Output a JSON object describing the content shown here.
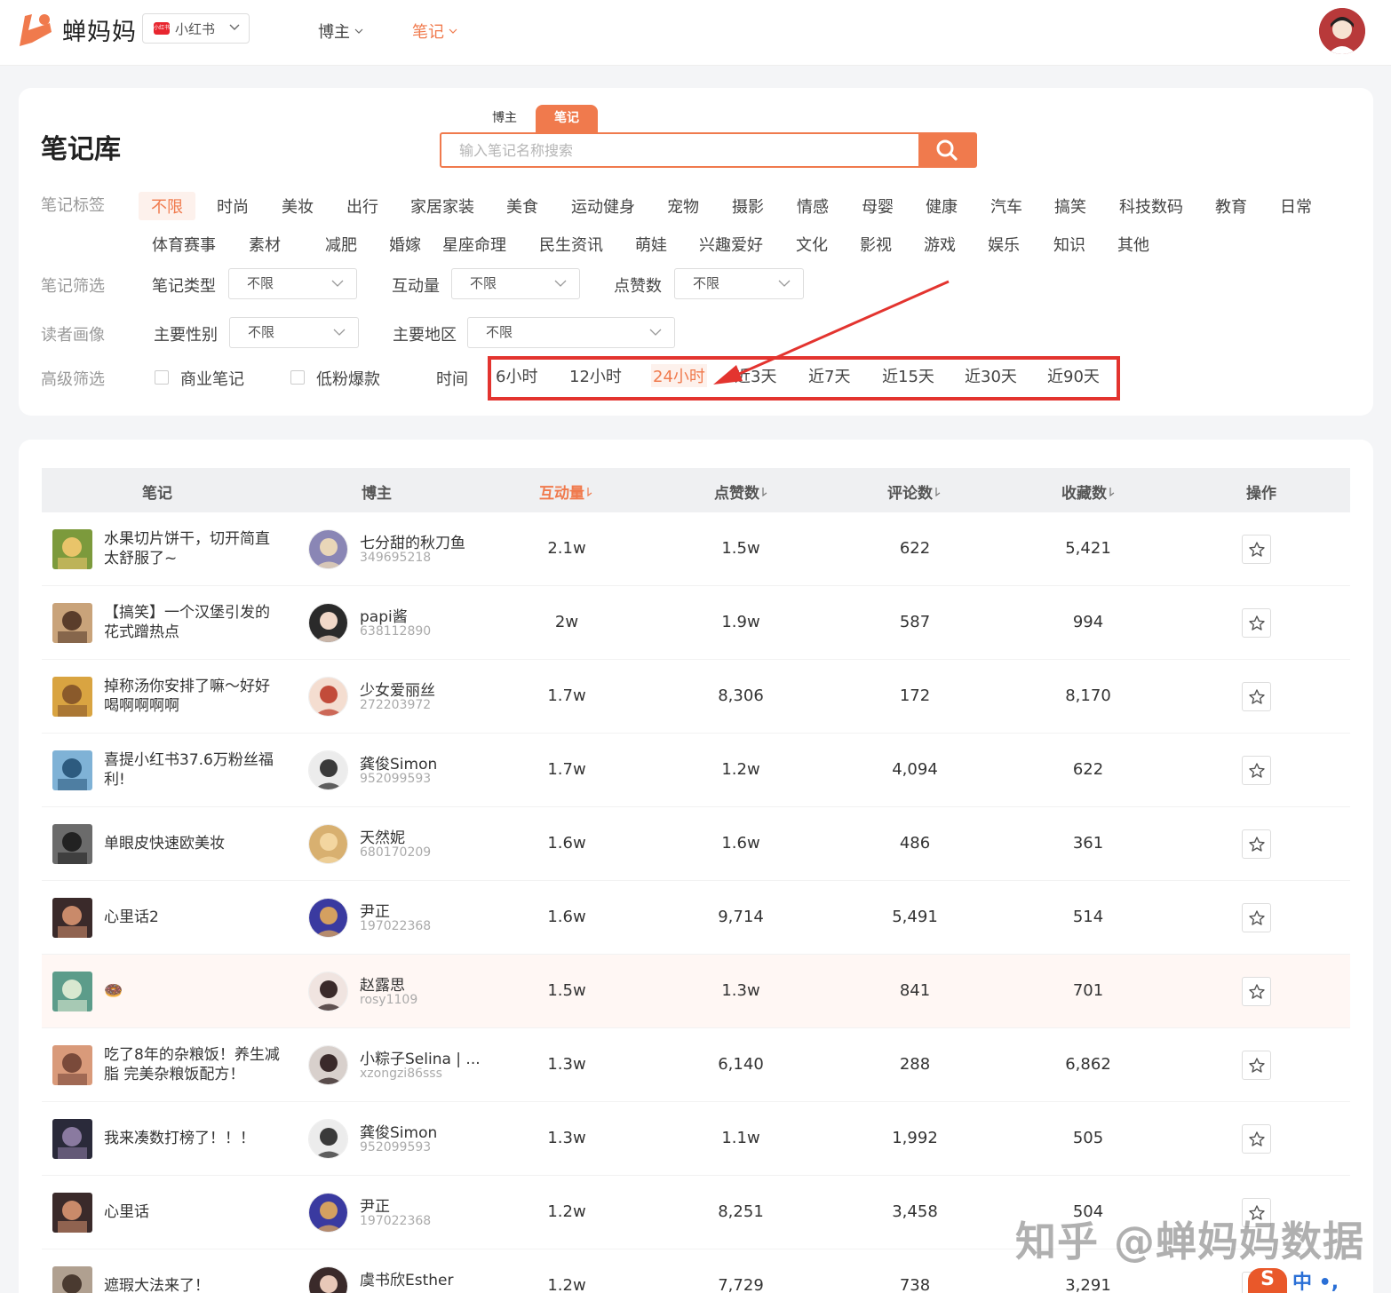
{
  "app": {
    "brand": "蝉妈妈",
    "platform": "小红书",
    "platform_badge": "小红书",
    "nav": [
      {
        "label": "博主",
        "active": false
      },
      {
        "label": "笔记",
        "active": true
      }
    ]
  },
  "filter": {
    "title": "笔记库",
    "search_tabs": [
      "博主",
      "笔记"
    ],
    "search_placeholder": "输入笔记名称搜索",
    "labels": {
      "tags": "笔记标签",
      "filter": "笔记筛选",
      "reader": "读者画像",
      "advanced": "高级筛选"
    },
    "tags_row1": [
      "不限",
      "时尚",
      "美妆",
      "出行",
      "家居家装",
      "美食",
      "运动健身",
      "宠物",
      "摄影",
      "情感",
      "母婴",
      "健康",
      "汽车",
      "搞笑",
      "科技数码",
      "教育",
      "日常"
    ],
    "tags_row2": [
      "体育赛事",
      "素材",
      "减肥",
      "婚嫁",
      "星座命理",
      "民生资讯",
      "萌娃",
      "兴趣爱好",
      "文化",
      "影视",
      "游戏",
      "娱乐",
      "知识",
      "其他"
    ],
    "note_filters": [
      {
        "label": "笔记类型",
        "value": "不限"
      },
      {
        "label": "互动量",
        "value": "不限"
      },
      {
        "label": "点赞数",
        "value": "不限"
      }
    ],
    "reader_filters": [
      {
        "label": "主要性别",
        "value": "不限"
      },
      {
        "label": "主要地区",
        "value": "不限"
      }
    ],
    "checks": [
      "商业笔记",
      "低粉爆款"
    ],
    "time_label": "时间",
    "time_options": [
      "6小时",
      "12小时",
      "24小时",
      "近3天",
      "近7天",
      "近15天",
      "近30天",
      "近90天"
    ],
    "time_selected": "24小时"
  },
  "table": {
    "headers": [
      "笔记",
      "博主",
      "互动量",
      "点赞数",
      "评论数",
      "收藏数",
      "操作"
    ],
    "sorted_column": "互动量",
    "rows": [
      {
        "title": "水果切片饼干，切开简直太舒服了~",
        "blogger": "七分甜的秋刀鱼",
        "id": "349695218",
        "interact": "2.1w",
        "likes": "1.5w",
        "comments": "622",
        "favs": "5,421"
      },
      {
        "title": "【搞笑】一个汉堡引发的花式蹭热点",
        "blogger": "papi酱",
        "id": "638112890",
        "interact": "2w",
        "likes": "1.9w",
        "comments": "587",
        "favs": "994"
      },
      {
        "title": "掉称汤你安排了嘛～好好喝啊啊啊啊",
        "blogger": "少女爱丽丝",
        "id": "272203972",
        "interact": "1.7w",
        "likes": "8,306",
        "comments": "172",
        "favs": "8,170"
      },
      {
        "title": "喜提小红书37.6万粉丝福利!",
        "blogger": "龚俊Simon",
        "id": "952099593",
        "interact": "1.7w",
        "likes": "1.2w",
        "comments": "4,094",
        "favs": "622"
      },
      {
        "title": "单眼皮快速欧美妆",
        "blogger": "天然妮",
        "id": "680170209",
        "interact": "1.6w",
        "likes": "1.6w",
        "comments": "486",
        "favs": "361"
      },
      {
        "title": "心里话2",
        "blogger": "尹正",
        "id": "197022368",
        "interact": "1.6w",
        "likes": "9,714",
        "comments": "5,491",
        "favs": "514"
      },
      {
        "title": "🍩",
        "blogger": "赵露思",
        "id": "rosy1109",
        "interact": "1.5w",
        "likes": "1.3w",
        "comments": "841",
        "favs": "701"
      },
      {
        "title": "吃了8年的杂粮饭！养生减脂 完美杂粮饭配方！",
        "blogger": "小粽子Selina | ...",
        "id": "xzongzi86sss",
        "interact": "1.3w",
        "likes": "6,140",
        "comments": "288",
        "favs": "6,862"
      },
      {
        "title": "我来凑数打榜了！！！",
        "blogger": "龚俊Simon",
        "id": "952099593",
        "interact": "1.3w",
        "likes": "1.1w",
        "comments": "1,992",
        "favs": "505"
      },
      {
        "title": "心里话",
        "blogger": "尹正",
        "id": "197022368",
        "interact": "1.2w",
        "likes": "8,251",
        "comments": "3,458",
        "favs": "504"
      },
      {
        "title": "遮瑕大法来了！",
        "blogger": "虞书欣Esther",
        "id": "",
        "interact": "1.2w",
        "likes": "7,729",
        "comments": "738",
        "favs": "3,291"
      }
    ]
  },
  "watermark": "知乎 @蝉妈妈数据",
  "ime": {
    "logo": "S",
    "text": "中 •,"
  },
  "colors": {
    "accent": "#f07a4d",
    "highlight_box": "#e3342f"
  }
}
